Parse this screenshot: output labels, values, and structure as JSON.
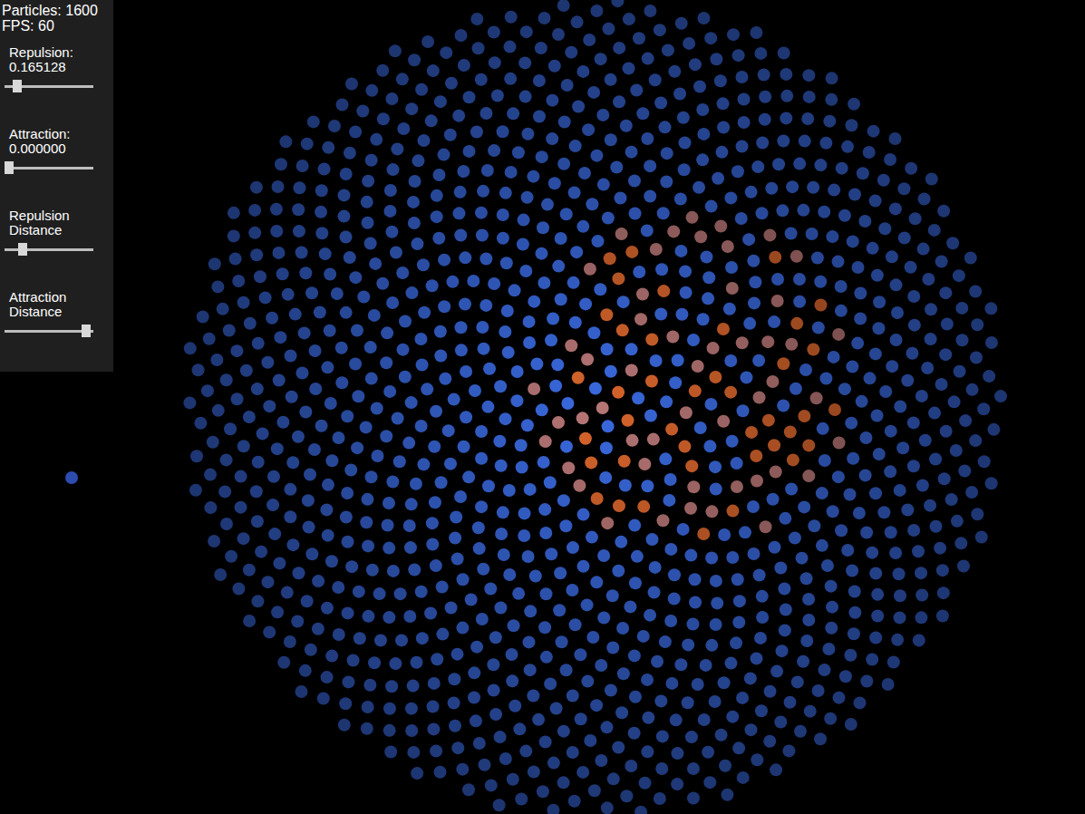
{
  "stats": {
    "particles": "Particles: 1600",
    "fps": "FPS: 60"
  },
  "sliders": [
    {
      "label": "Repulsion:",
      "value": "0.165128",
      "level": 0.1
    },
    {
      "label": "Attraction:",
      "value": "0.000000",
      "level": 0.0
    },
    {
      "label": "Repulsion Distance",
      "value": "",
      "level": 0.17
    },
    {
      "label": "Attraction Distance",
      "value": "",
      "level": 0.97
    }
  ],
  "field": {
    "groups": [
      {
        "name": "blue",
        "color": "#3a6ae0",
        "count": 1000
      },
      {
        "name": "orange",
        "color": "#d8652c",
        "count": 40
      },
      {
        "name": "pink",
        "color": "#b87676",
        "count": 50
      }
    ],
    "strays": [
      {
        "color": "#c0532a"
      },
      {
        "color": "#2c4cb0"
      },
      {
        "color": "#2c4cb0"
      }
    ]
  }
}
